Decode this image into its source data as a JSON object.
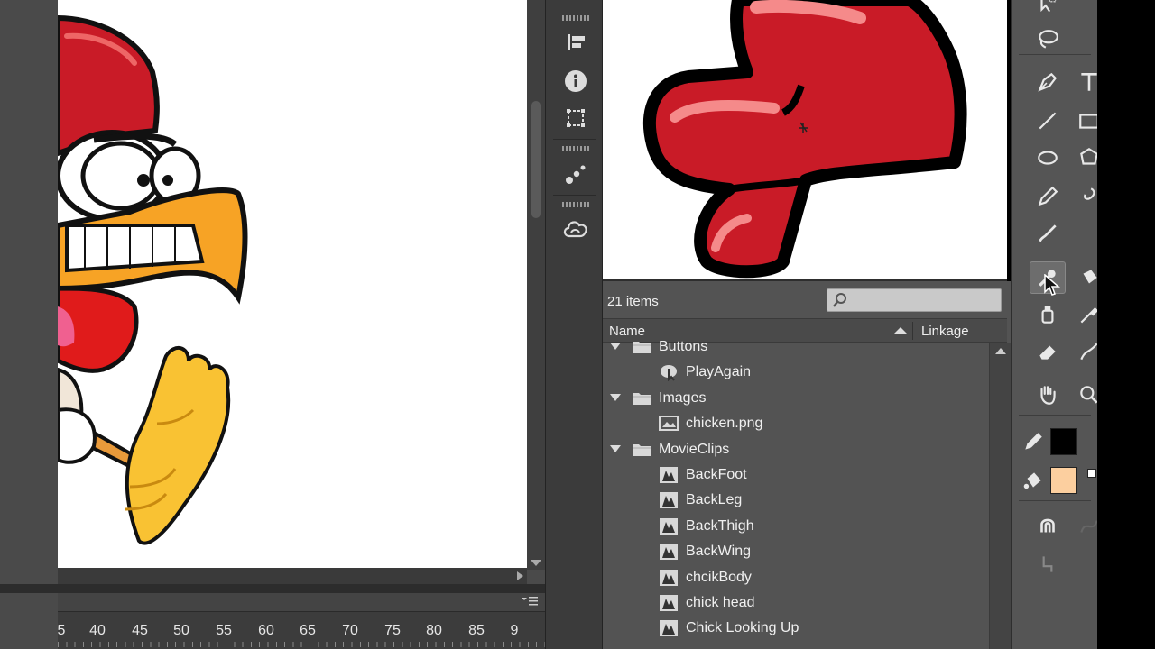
{
  "colors": {
    "panel_bg": "#535353",
    "stage_bg": "#ffffff",
    "stroke_color": "#000000",
    "fill_color": "#fccf9f",
    "chicken_red": "#c91b27"
  },
  "timeline": {
    "menu_icon": "panel-menu-icon",
    "ruler_labels": [
      "5",
      "40",
      "45",
      "50",
      "55",
      "60",
      "65",
      "70",
      "75",
      "80",
      "85",
      "9"
    ]
  },
  "panel_strip": {
    "items": [
      {
        "name": "align-icon"
      },
      {
        "name": "info-icon"
      },
      {
        "name": "transform-icon"
      },
      {
        "name": "motion-presets-icon"
      },
      {
        "name": "creative-cloud-libraries-icon"
      }
    ]
  },
  "library": {
    "item_count": "21 items",
    "search_placeholder": "",
    "columns": {
      "name": "Name",
      "linkage": "Linkage"
    },
    "rows": [
      {
        "type": "folder",
        "label": "Buttons",
        "indent": 0
      },
      {
        "type": "button",
        "label": "PlayAgain",
        "indent": 1
      },
      {
        "type": "folder",
        "label": "Images",
        "indent": 0
      },
      {
        "type": "bitmap",
        "label": "chicken.png",
        "indent": 1
      },
      {
        "type": "folder",
        "label": "MovieClips",
        "indent": 0
      },
      {
        "type": "movieclip",
        "label": "BackFoot",
        "indent": 1
      },
      {
        "type": "movieclip",
        "label": "BackLeg",
        "indent": 1
      },
      {
        "type": "movieclip",
        "label": "BackThigh",
        "indent": 1
      },
      {
        "type": "movieclip",
        "label": "BackWing",
        "indent": 1
      },
      {
        "type": "movieclip",
        "label": "chcikBody",
        "indent": 1
      },
      {
        "type": "movieclip",
        "label": "chick head",
        "indent": 1
      },
      {
        "type": "movieclip",
        "label": "Chick Looking Up",
        "indent": 1
      }
    ]
  },
  "tools": {
    "items": [
      "subselection-icon",
      "lasso-icon",
      "pen-icon",
      "text-icon",
      "line-icon",
      "rectangle-icon",
      "oval-icon",
      "polystar-icon",
      "pencil-icon",
      "brush-icon",
      "paint-brush-icon",
      "bone-icon",
      "paint-bucket-icon",
      "ink-bottle-icon",
      "eyedropper-icon",
      "eraser-icon",
      "width-icon",
      "hand-icon",
      "zoom-icon",
      "stroke-color-icon",
      "fill-color-icon",
      "snap-to-objects-icon",
      "smooth-icon",
      "straighten-icon"
    ],
    "active_tool": "bone-icon"
  }
}
